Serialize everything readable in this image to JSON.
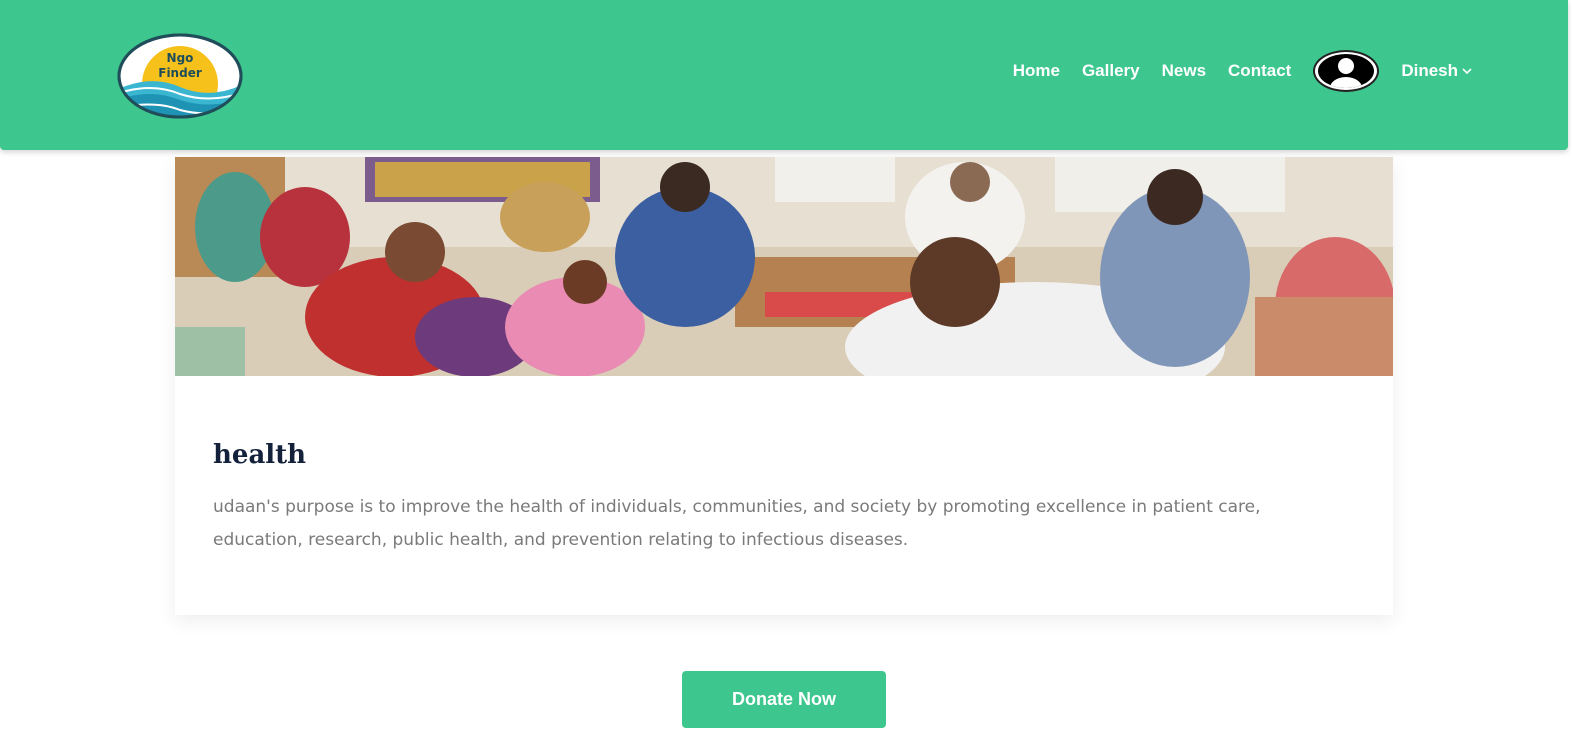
{
  "brand": {
    "logo_line1": "Ngo",
    "logo_line2": "Finder"
  },
  "nav": {
    "items": [
      {
        "label": "Home"
      },
      {
        "label": "Gallery"
      },
      {
        "label": "News"
      },
      {
        "label": "Contact"
      }
    ],
    "user_name": "Dinesh"
  },
  "card": {
    "title": "health",
    "description": "udaan's purpose is to improve the health of individuals, communities, and society by promoting excellence in patient care, education, research, public health, and prevention relating to infectious diseases."
  },
  "actions": {
    "donate_label": "Donate Now"
  },
  "colors": {
    "primary": "#3dc78f",
    "title": "#13213a",
    "text": "#7a7a7a"
  }
}
